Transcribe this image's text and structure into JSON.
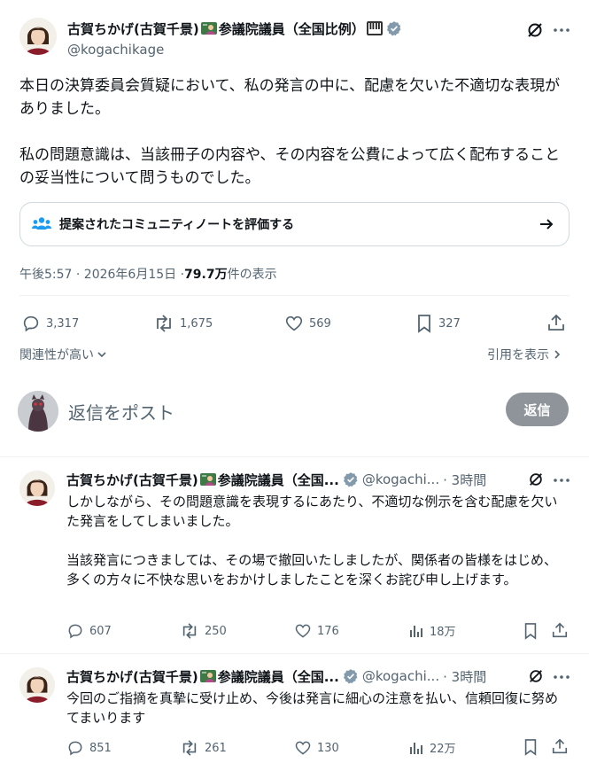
{
  "main": {
    "author_name": "古賀ちかげ(古賀千景)",
    "author_title": "参議院議員（全国比例）",
    "handle": "@kogachikage",
    "paragraph1": "本日の決算委員会質疑において、私の発言の中に、配慮を欠いた不適切な表現がありました。",
    "paragraph2": "私の問題意識は、当該冊子の内容や、その内容を公費によって広く配布することの妥当性について問うものでした。",
    "community_note": "提案されたコミュニティノートを評価する",
    "timestamp": "午後5:57 · 2026年6月15日 · ",
    "views_count": "79.7万",
    "views_label": " 件の表示",
    "stats": {
      "replies": "3,317",
      "reposts": "1,675",
      "likes": "569",
      "bookmarks": "327"
    },
    "sort_label": "関連性が高い",
    "quotes_label": "引用を表示",
    "reply_placeholder": "返信をポスト",
    "reply_button": "返信"
  },
  "replies": [
    {
      "author_name": "古賀ちかげ(古賀千景)",
      "author_title": "参議院議員（全国...",
      "handle": "@kogachi...",
      "time": "· 3時間",
      "paragraph1": "しかしながら、その問題意識を表現するにあたり、不適切な例示を含む配慮を欠いた発言をしてしまいました。",
      "paragraph2": "当該発言につきましては、その場で撤回いたしましたが、関係者の皆様をはじめ、多くの方々に不快な思いをおかけしましたことを深くお詫び申し上げます。",
      "stats": {
        "replies": "607",
        "reposts": "250",
        "likes": "176",
        "views": "18万"
      }
    },
    {
      "author_name": "古賀ちかげ(古賀千景)",
      "author_title": "参議院議員（全国...",
      "handle": "@kogachi...",
      "time": "· 3時間",
      "paragraph1": "今回のご指摘を真摯に受け止め、今後は発言に細心の注意を払い、信頼回復に努めてまいります",
      "stats": {
        "replies": "851",
        "reposts": "261",
        "likes": "130",
        "views": "22万"
      }
    }
  ],
  "colors": {
    "verified": "#829aab",
    "text": "#0f1419",
    "muted": "#536471",
    "divider": "#eff3f4",
    "reply_button": "#8e9499"
  },
  "icons": [
    "teacher-emoji-icon",
    "piano-emoji-icon",
    "verified-badge-icon",
    "grok-icon",
    "more-icon",
    "community-notes-icon",
    "arrow-right-icon",
    "reply-icon",
    "repost-icon",
    "like-icon",
    "bookmark-icon",
    "share-icon",
    "chevron-down-icon",
    "chevron-right-icon",
    "views-icon"
  ]
}
